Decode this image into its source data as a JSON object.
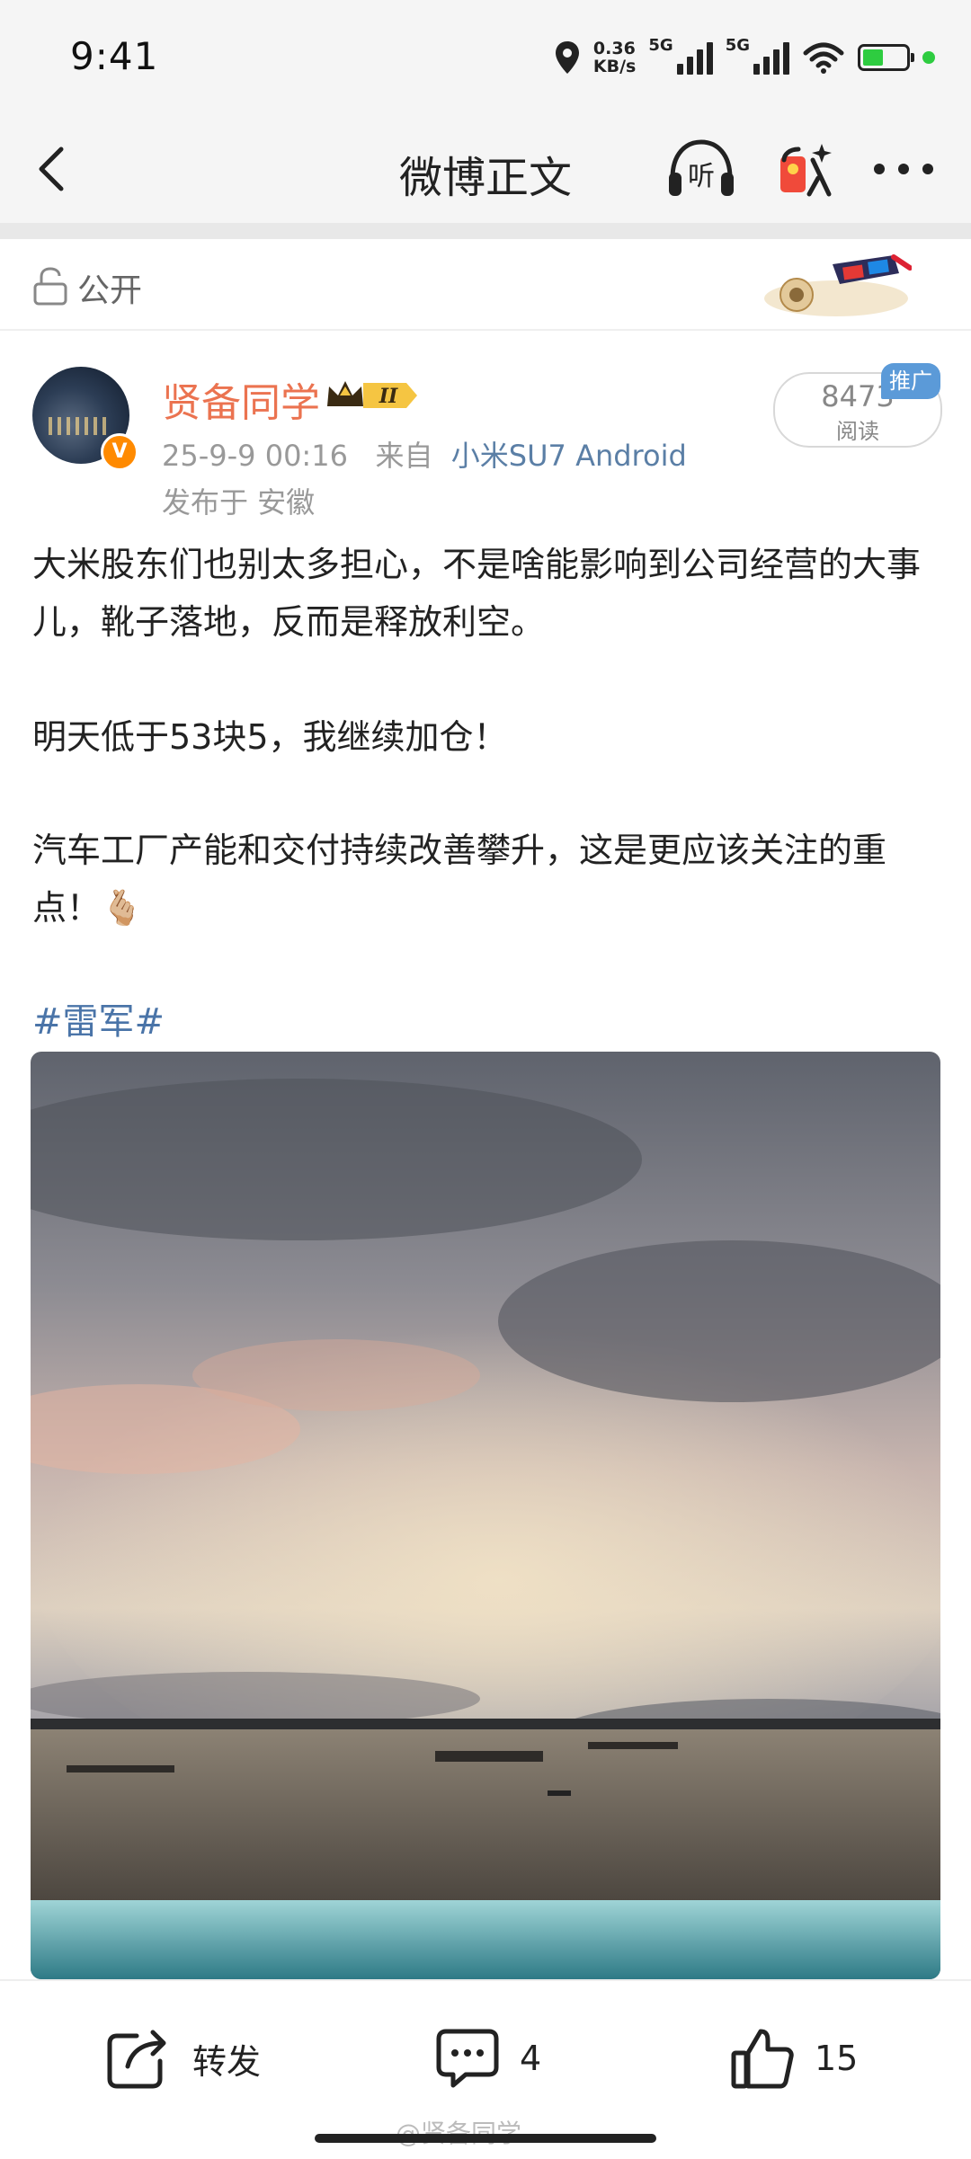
{
  "status_bar": {
    "time": "9:41",
    "net_speed_value": "0.36",
    "net_speed_unit": "KB/s",
    "network_1": "5G",
    "network_2": "5G"
  },
  "nav": {
    "title": "微博正文",
    "back_icon": "chevron-left-icon",
    "listen_label": "听",
    "gift_icon": "red-packet-icon",
    "more_icon": "more-horizontal-icon"
  },
  "visibility": {
    "label": "公开",
    "icon": "unlock-icon"
  },
  "post": {
    "author": "贤备同学",
    "verified_mark": "V",
    "member_level": "II",
    "date": "25-9-9 00:16",
    "source_prefix": "来自",
    "source": "小米SU7 Android",
    "location": "发布于 安徽",
    "read_count": "8473",
    "read_label": "阅读",
    "promo_tag": "推广",
    "paragraphs": [
      "大米股东们也别太多担心，不是啥能影响到公司经营的大事儿，靴子落地，反而是释放利空。",
      "明天低于53块5，我继续加仓！",
      "汽车工厂产能和交付持续改善攀升，这是更应该关注的重点！🫰🏼"
    ],
    "hashtag": "#雷军#"
  },
  "actions": {
    "repost_label": "转发",
    "comment_count": "4",
    "like_count": "15"
  },
  "watermark": "@贤备同学",
  "colors": {
    "author_name": "#eb7350",
    "link_blue": "#4a74a8",
    "promo_blue": "#5b9ad8",
    "verify_orange": "#ff8a00"
  }
}
